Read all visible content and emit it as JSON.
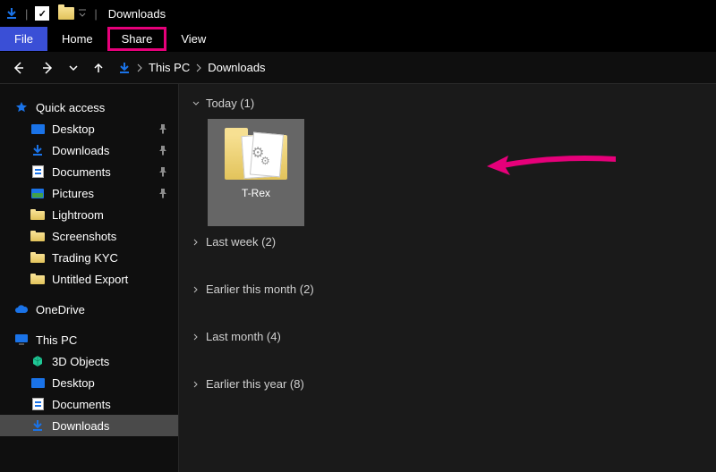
{
  "window": {
    "title": "Downloads"
  },
  "ribbon": {
    "file": "File",
    "tabs": [
      "Home",
      "Share",
      "View"
    ],
    "highlighted_index": 1
  },
  "breadcrumb": {
    "segments": [
      "This PC",
      "Downloads"
    ]
  },
  "sidebar": {
    "quick_access": {
      "label": "Quick access",
      "items": [
        {
          "label": "Desktop",
          "icon": "desktop",
          "pinned": true
        },
        {
          "label": "Downloads",
          "icon": "download",
          "pinned": true
        },
        {
          "label": "Documents",
          "icon": "document",
          "pinned": true
        },
        {
          "label": "Pictures",
          "icon": "picture",
          "pinned": true
        },
        {
          "label": "Lightroom",
          "icon": "folder",
          "pinned": false
        },
        {
          "label": "Screenshots",
          "icon": "folder",
          "pinned": false
        },
        {
          "label": "Trading KYC",
          "icon": "folder",
          "pinned": false
        },
        {
          "label": "Untitled Export",
          "icon": "folder",
          "pinned": false
        }
      ]
    },
    "onedrive": {
      "label": "OneDrive"
    },
    "this_pc": {
      "label": "This PC",
      "items": [
        {
          "label": "3D Objects",
          "icon": "cube"
        },
        {
          "label": "Desktop",
          "icon": "desktop"
        },
        {
          "label": "Documents",
          "icon": "document"
        },
        {
          "label": "Downloads",
          "icon": "download",
          "selected": true
        }
      ]
    }
  },
  "content": {
    "groups": [
      {
        "label": "Today (1)",
        "expanded": true,
        "items": [
          {
            "name": "T-Rex",
            "kind": "folder-with-docs",
            "selected": true
          }
        ]
      },
      {
        "label": "Last week (2)",
        "expanded": false
      },
      {
        "label": "Earlier this month (2)",
        "expanded": false
      },
      {
        "label": "Last month (4)",
        "expanded": false
      },
      {
        "label": "Earlier this year (8)",
        "expanded": false
      }
    ]
  },
  "annotations": {
    "share_tab_highlight_color": "#e6007a",
    "arrow_color": "#e6007a"
  }
}
